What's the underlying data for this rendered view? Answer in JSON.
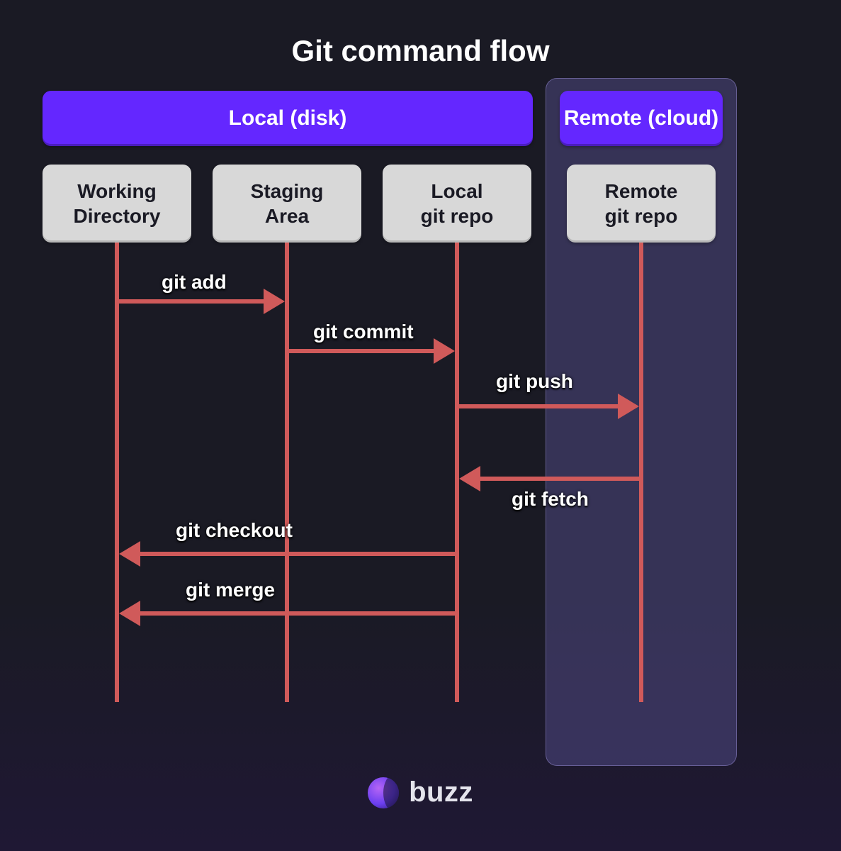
{
  "title": "Git command flow",
  "regions": {
    "local": "Local (disk)",
    "remote": "Remote (cloud)"
  },
  "nodes": {
    "working": {
      "line1": "Working",
      "line2": "Directory"
    },
    "staging": {
      "line1": "Staging",
      "line2": "Area"
    },
    "localrepo": {
      "line1": "Local",
      "line2": "git repo"
    },
    "remoterepo": {
      "line1": "Remote",
      "line2": "git repo"
    }
  },
  "commands": {
    "add": "git add",
    "commit": "git commit",
    "push": "git push",
    "fetch": "git fetch",
    "checkout": "git checkout",
    "merge": "git merge"
  },
  "brand": "buzz",
  "colors": {
    "accent": "#6427ff",
    "arrow": "#d05a5a",
    "node": "#d8d8d8",
    "bg": "#1a1a24"
  }
}
